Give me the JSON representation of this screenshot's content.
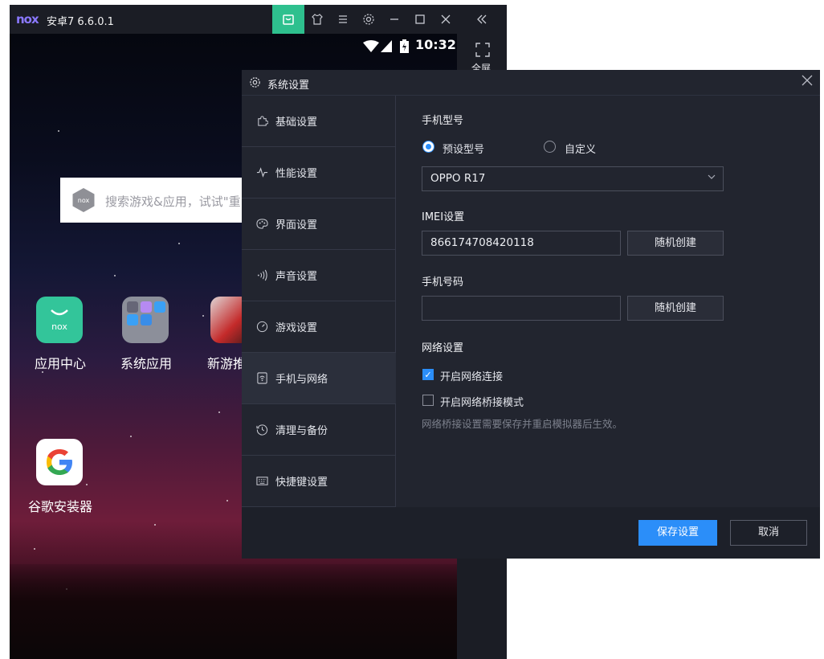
{
  "emulator": {
    "logo": "nox",
    "title": "安卓7 6.6.0.1",
    "toolbar_icons": [
      "store-icon",
      "shirt-icon",
      "menu-icon",
      "gear-icon",
      "minimize-icon",
      "maximize-icon",
      "close-icon",
      "collapse-icon"
    ],
    "accent_color": "#2ec08e",
    "status_time": "10:32",
    "fullscreen_label": "全屏",
    "search_placeholder": "搜索游戏&应用，试试\"重",
    "apps": [
      {
        "label": "应用中心"
      },
      {
        "label": "系统应用"
      },
      {
        "label": "新游推"
      },
      {
        "label": "谷歌安装器"
      }
    ]
  },
  "dialog": {
    "title": "系统设置",
    "nav": [
      {
        "label": "基础设置",
        "icon": "puzzle-icon"
      },
      {
        "label": "性能设置",
        "icon": "pulse-icon"
      },
      {
        "label": "界面设置",
        "icon": "palette-icon"
      },
      {
        "label": "声音设置",
        "icon": "sound-icon"
      },
      {
        "label": "游戏设置",
        "icon": "gauge-icon"
      },
      {
        "label": "手机与网络",
        "icon": "phone-wifi-icon",
        "active": true
      },
      {
        "label": "清理与备份",
        "icon": "history-icon"
      },
      {
        "label": "快捷键设置",
        "icon": "keyboard-icon"
      }
    ],
    "phone_model": {
      "title": "手机型号",
      "option_preset": "预设型号",
      "option_custom": "自定义",
      "selected": "预设型号",
      "model_value": "OPPO R17"
    },
    "imei": {
      "title": "IMEI设置",
      "value": "866174708420118",
      "random_button": "随机创建"
    },
    "phone_number": {
      "title": "手机号码",
      "value": "",
      "random_button": "随机创建"
    },
    "network": {
      "title": "网络设置",
      "enable_network_label": "开启网络连接",
      "enable_network_checked": true,
      "bridge_mode_label": "开启网络桥接模式",
      "bridge_mode_checked": false,
      "hint": "网络桥接设置需要保存并重启模拟器后生效。"
    },
    "footer": {
      "save_label": "保存设置",
      "cancel_label": "取消"
    },
    "accent_color": "#2b8ef9"
  }
}
